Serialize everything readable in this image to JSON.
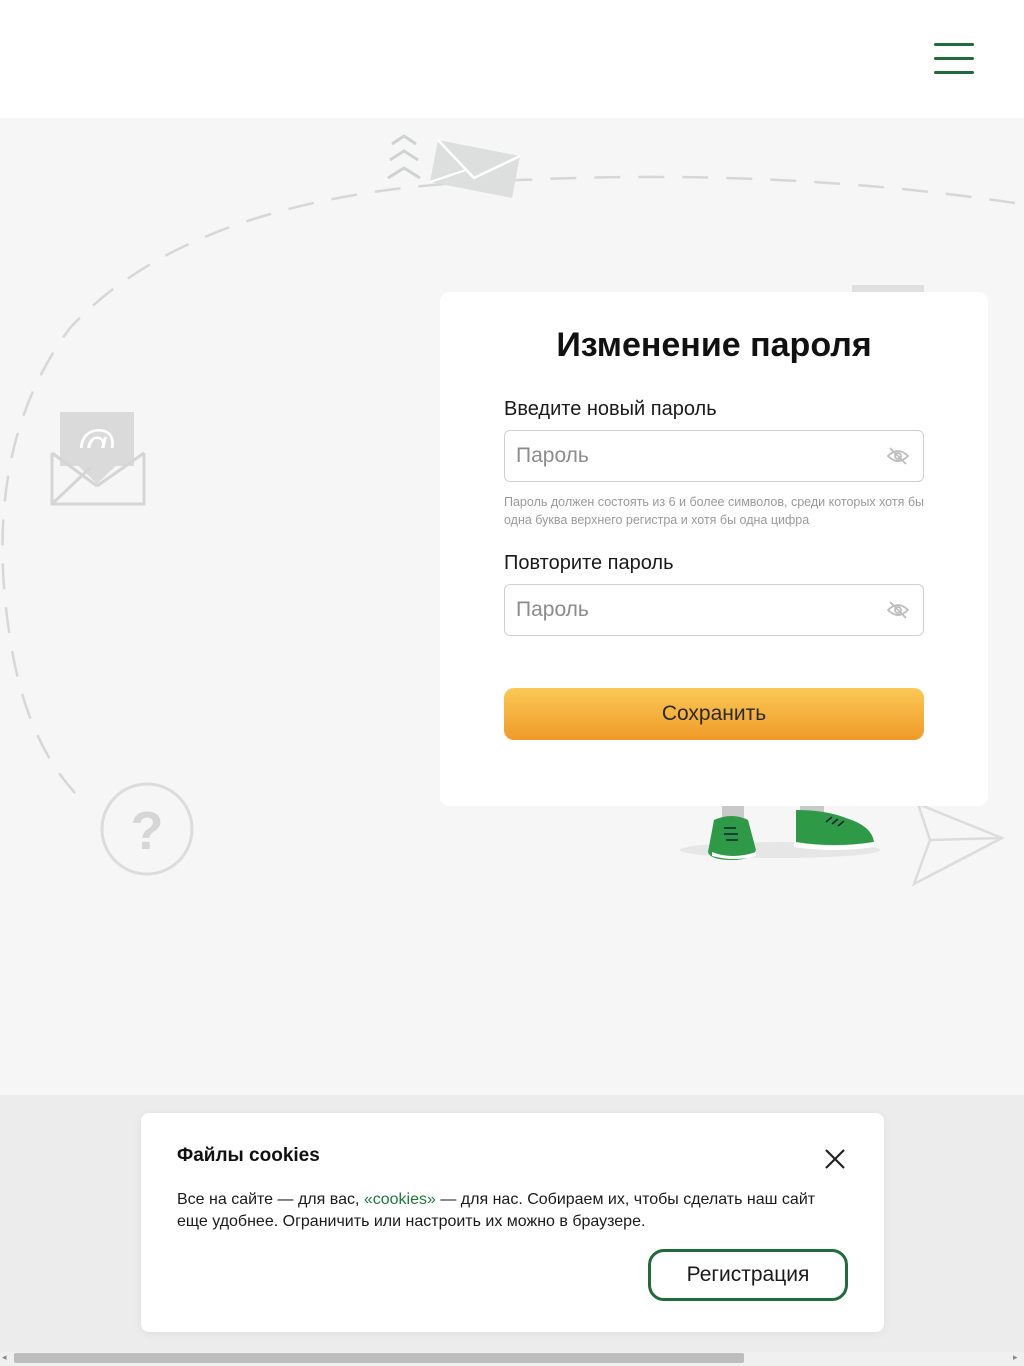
{
  "header": {
    "menu_icon": "hamburger-menu-icon"
  },
  "illustration": {
    "icons": [
      "envelope-icon",
      "email-at-icon",
      "question-icon",
      "paper-plane-icon",
      "sneakers-icon"
    ]
  },
  "form": {
    "title": "Изменение пароля",
    "new_password": {
      "label": "Введите новый пароль",
      "placeholder": "Пароль",
      "value": ""
    },
    "hint": "Пароль должен состоять из 6 и более символов, среди которых хотя бы одна буква верхнего регистра и хотя бы одна цифра",
    "repeat_password": {
      "label": "Повторите пароль",
      "placeholder": "Пароль",
      "value": ""
    },
    "visibility_icon": "eye-hidden-icon",
    "save_label": "Сохранить"
  },
  "cookie": {
    "title": "Файлы cookies",
    "text_before": "Все на сайте — для вас, ",
    "link": "«cookies»",
    "text_after": " — для нас. Собираем их, чтобы сделать наш сайт еще удобнее. Ограничить или настроить их можно в браузере.",
    "button_label": "Регистрация"
  },
  "colors": {
    "brand_green": "#1f6b39",
    "button_orange": "#f09a28",
    "link_green": "#1f7a3a"
  }
}
